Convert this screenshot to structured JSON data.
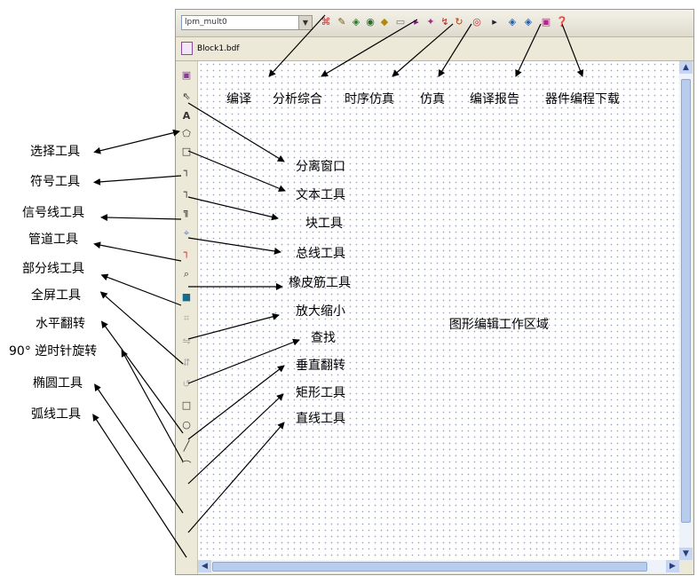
{
  "toolbar": {
    "device_select": "lpm_mult0",
    "icons": [
      "compile-icon",
      "analysis-icon",
      "timing-sim-icon",
      "sim-icon",
      "report-icon",
      "program-icon",
      "run-icon",
      "probe-icon",
      "stop-icon",
      "refresh-icon",
      "clock-icon",
      "pointer-icon",
      "chip-icon",
      "chip2-icon",
      "download-icon",
      "help-icon"
    ]
  },
  "tab": {
    "label": "Block1.bdf"
  },
  "top_labels": [
    "编译",
    "分析综合",
    "时序仿真",
    "仿真",
    "编译报告",
    "器件编程下载"
  ],
  "left_labels": [
    "选择工具",
    "符号工具",
    "信号线工具",
    "管道工具",
    "部分线工具",
    "全屏工具",
    "水平翻转",
    "90° 逆时针旋转",
    "椭圆工具",
    "弧线工具"
  ],
  "mid_labels": [
    "分离窗口",
    "文本工具",
    "块工具",
    "总线工具",
    "橡皮筋工具",
    "放大缩小",
    "查找",
    "垂直翻转",
    "矩形工具",
    "直线工具"
  ],
  "canvas_label": "图形编辑工作区域",
  "colors": {
    "canvas_dots": "#9aa4c0",
    "scroll_thumb": "#b8cdee"
  }
}
